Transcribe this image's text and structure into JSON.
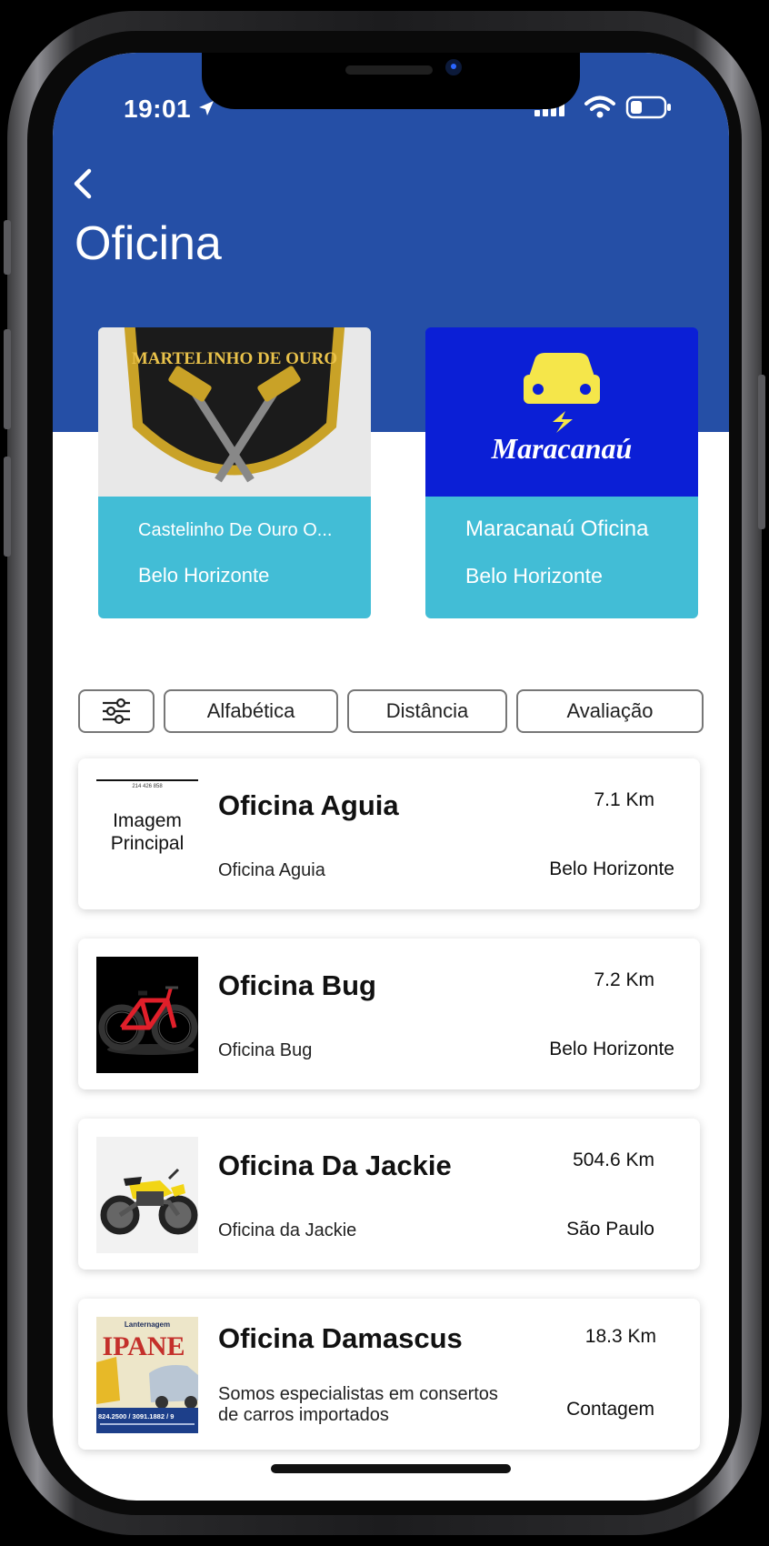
{
  "status_bar": {
    "time": "19:01"
  },
  "header": {
    "title": "Oficina",
    "back_icon": "chevron-left-icon"
  },
  "featured": [
    {
      "logo_text": "MARTELINHO DE OURO",
      "name": "Castelinho De Ouro O...",
      "city": "Belo Horizonte"
    },
    {
      "logo_text": "Maracanaú",
      "name": "Maracanaú Oficina",
      "city": "Belo Horizonte"
    }
  ],
  "filters": {
    "icon": "sliders-icon",
    "alphabetical": "Alfabética",
    "distance": "Distância",
    "rating": "Avaliação"
  },
  "workshops": [
    {
      "title": "Oficina Aguia",
      "description": "Oficina Aguia",
      "distance": "7.1 Km",
      "city": "Belo Horizonte",
      "thumb_text": "Imagem Principal",
      "thumb_caption": "214 426 858"
    },
    {
      "title": "Oficina Bug",
      "description": "Oficina Bug",
      "distance": "7.2 Km",
      "city": "Belo Horizonte"
    },
    {
      "title": "Oficina Da Jackie",
      "description": "Oficina da Jackie",
      "distance": "504.6 Km",
      "city": "São Paulo"
    },
    {
      "title": "Oficina Damascus",
      "description": "Somos especialistas em consertos de carros importados",
      "distance": "18.3 Km",
      "city": "Contagem",
      "thumb_text": "IPANE",
      "thumb_subtext": "Lanternagem",
      "thumb_caption": "824.2500 / 3091.1882 / 9"
    }
  ],
  "colors": {
    "header_bg": "#254fa6",
    "card_bg": "#42bdd6",
    "logo_blue": "#0b1fd6",
    "logo_yellow": "#f5e64a"
  }
}
